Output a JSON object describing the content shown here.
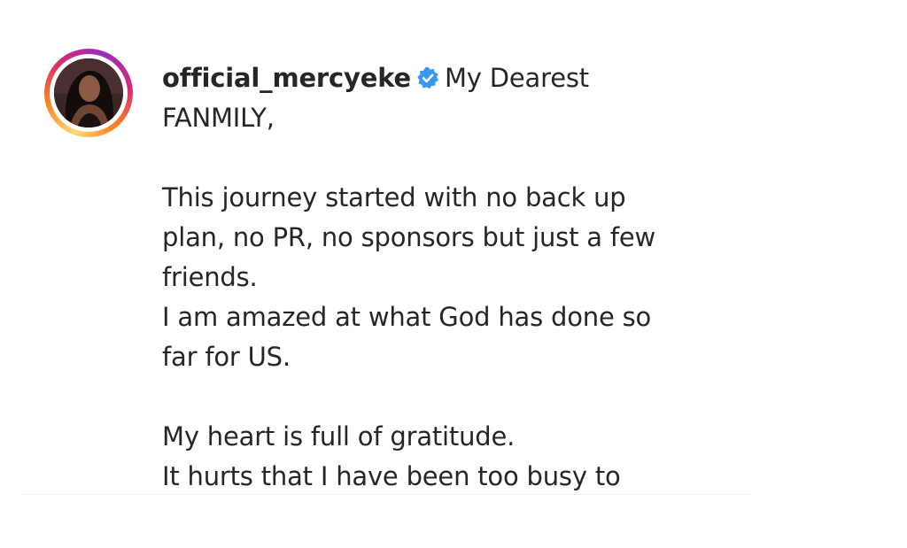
{
  "post": {
    "username": "official_mercyeke",
    "verified_icon": "verified-badge-icon",
    "verified_color": "#3897f0",
    "caption_first": "My Dearest",
    "caption_lines": [
      "FANMILY,",
      "",
      "This journey started with no back up",
      "plan, no PR, no sponsors but just a few",
      "friends.",
      "I am amazed at what God has done so",
      "far for US.",
      "",
      "My heart is full of gratitude.",
      "It hurts that I have been too busy to"
    ]
  },
  "avatar": {
    "icon": "profile-avatar",
    "ring_colors": [
      "#feda75",
      "#fa7e1e",
      "#d62976",
      "#962fbf"
    ]
  }
}
